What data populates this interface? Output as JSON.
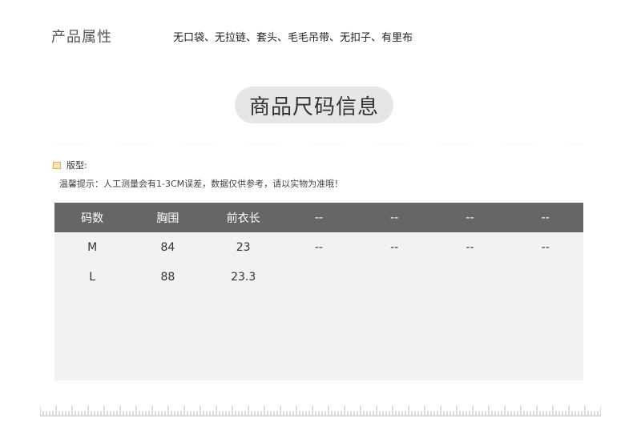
{
  "attributes": {
    "label": "产品属性",
    "value": "无口袋、无拉链、套头、毛毛吊带、无扣子、有里布"
  },
  "section_title": "商品尺码信息",
  "fit": {
    "label": "版型:",
    "tip": "温馨提示：人工测量会有1-3CM误差，数据仅供参考，请以实物为准哦！"
  },
  "size_table": {
    "headers": [
      "码数",
      "胸围",
      "前衣长",
      "--",
      "--",
      "--",
      "--"
    ],
    "rows": [
      [
        "M",
        "84",
        "23",
        "--",
        "--",
        "--",
        "--"
      ],
      [
        "L",
        "88",
        "23.3",
        "",
        "",
        "",
        ""
      ]
    ]
  },
  "colors": {
    "header_bg": "#666666",
    "table_bg": "#f2f2f2",
    "title_pill_bg": "#e6e6e6"
  }
}
